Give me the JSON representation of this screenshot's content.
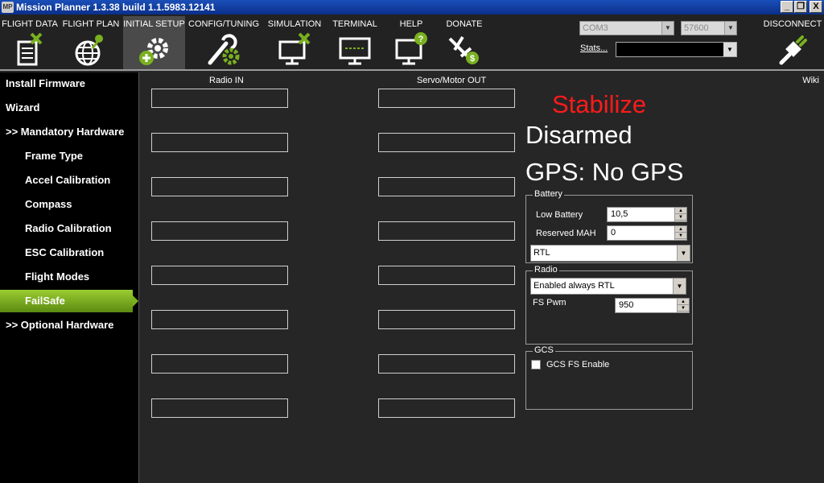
{
  "window": {
    "title": "Mission Planner 1.3.38 build 1.1.5983.12141",
    "icon_label": "MP",
    "buttons": [
      "_",
      "❐",
      "X"
    ]
  },
  "toolbar": {
    "menu": [
      {
        "label": "FLIGHT DATA",
        "icon": "flight-data-icon"
      },
      {
        "label": "FLIGHT PLAN",
        "icon": "flight-plan-icon"
      },
      {
        "label": "INITIAL SETUP",
        "icon": "initial-setup-icon"
      },
      {
        "label": "CONFIG/TUNING",
        "icon": "config-tuning-icon"
      },
      {
        "label": "SIMULATION",
        "icon": "simulation-icon"
      },
      {
        "label": "TERMINAL",
        "icon": "terminal-icon"
      },
      {
        "label": "HELP",
        "icon": "help-icon"
      },
      {
        "label": "DONATE",
        "icon": "donate-icon"
      }
    ],
    "port": "COM3",
    "baud": "57600",
    "stats_label": "Stats...",
    "disconnect_label": "DISCONNECT",
    "accent": "#7ab020"
  },
  "sidebar": {
    "items": [
      {
        "label": "Install Firmware"
      },
      {
        "label": "Wizard"
      },
      {
        "label": ">> Mandatory Hardware"
      },
      {
        "label": "Frame Type"
      },
      {
        "label": "Accel Calibration"
      },
      {
        "label": "Compass"
      },
      {
        "label": "Radio Calibration"
      },
      {
        "label": "ESC Calibration"
      },
      {
        "label": "Flight Modes"
      },
      {
        "label": "FailSafe"
      },
      {
        "label": ">> Optional Hardware"
      }
    ],
    "active_item": "FailSafe"
  },
  "main": {
    "radio_in_header": "Radio IN",
    "servo_out_header": "Servo/Motor OUT",
    "wiki_label": "Wiki",
    "status": {
      "mode": "Stabilize",
      "armed": "Disarmed",
      "gps": "GPS: No GPS",
      "mode_color": "#ff1a1a"
    },
    "battery": {
      "legend": "Battery",
      "low_battery_label": "Low Battery",
      "low_battery_value": "10,5",
      "reserved_mah_label": "Reserved MAH",
      "reserved_mah_value": "0",
      "action": "RTL"
    },
    "radio": {
      "legend": "Radio",
      "action": "Enabled always RTL",
      "fs_pwm_label": "FS Pwm",
      "fs_pwm_value": "950"
    },
    "gcs": {
      "legend": "GCS",
      "fs_enable_label": "GCS FS Enable",
      "fs_enable_checked": false
    }
  }
}
